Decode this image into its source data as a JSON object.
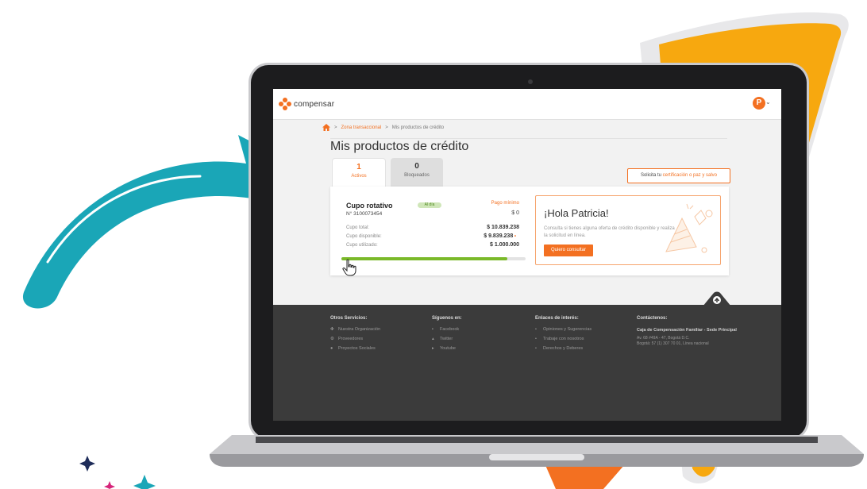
{
  "app": {
    "brand": "compensar",
    "avatar_letter": "P",
    "colors": {
      "accent": "#f37021",
      "success": "#7ab929",
      "footer": "#3b3b3b",
      "teal_arrow": "#1aa6b7",
      "decor_yellow": "#f7a80f"
    }
  },
  "breadcrumb": {
    "separator": ">",
    "items": [
      "Zona transaccional",
      "Mis productos de crédito"
    ]
  },
  "page": {
    "title": "Mis productos de crédito"
  },
  "tabs": [
    {
      "count": "1",
      "label": "Activos",
      "active": true
    },
    {
      "count": "0",
      "label": "Bloqueados",
      "active": false
    }
  ],
  "certificate_button": {
    "prefix": "Solicita tu",
    "highlight": "certificación o paz y salvo"
  },
  "card": {
    "title": "Cupo rotativo",
    "number": "N° 3100073454",
    "status": "Al día",
    "min_payment_label": "Pago mínimo",
    "min_payment_value": "$ 0",
    "rows": [
      {
        "label": "Cupo total:",
        "value": "$ 10.839.238"
      },
      {
        "label": "Cupo disponible:",
        "value": "$ 9.839.238"
      },
      {
        "label": "Cupo utilizado:",
        "value": "$ 1.000.000"
      }
    ],
    "usage_fraction": 0.9
  },
  "promo": {
    "title": "¡Hola Patricia!",
    "text": "Consulta si tienes alguna oferta de crédito disponible y realiza la solicitud en línea.",
    "button": "Quiero consultar"
  },
  "footer": {
    "columns": [
      {
        "title": "Otros Servicios:",
        "items": [
          {
            "icon": "handshake-icon",
            "label": "Nuestra Organización"
          },
          {
            "icon": "gear-icon",
            "label": "Proveedores"
          },
          {
            "icon": "people-icon",
            "label": "Proyectos Sociales"
          }
        ]
      },
      {
        "title": "Síguenos en:",
        "items": [
          {
            "icon": "facebook-icon",
            "label": "Facebook"
          },
          {
            "icon": "twitter-icon",
            "label": "Twitter"
          },
          {
            "icon": "youtube-icon",
            "label": "Youtube"
          }
        ]
      },
      {
        "title": "Enlaces de interés:",
        "items": [
          {
            "icon": "bullet-icon",
            "label": "Opiniones y Sugerencias"
          },
          {
            "icon": "bullet-icon",
            "label": "Trabaje con nosotros"
          },
          {
            "icon": "bullet-icon",
            "label": "Derechos y Deberes"
          }
        ]
      }
    ],
    "contact": {
      "title": "Contáctenos:",
      "org": "Caja de Compensación Familiar - Sede Principal",
      "address": "Av. 68 #49A - 47, Bogotá D.C.",
      "phone": "Bogotá: 57 (1) 307 70 01, Línea nacional"
    }
  }
}
